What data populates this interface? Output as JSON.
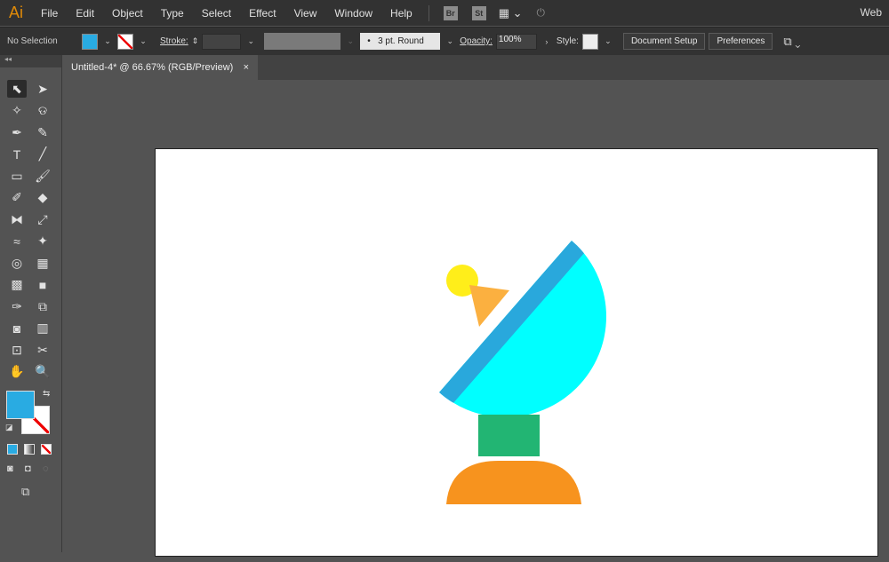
{
  "app": {
    "logo": "Ai",
    "workspace": "Web"
  },
  "menu": [
    "File",
    "Edit",
    "Object",
    "Type",
    "Select",
    "Effect",
    "View",
    "Window",
    "Help"
  ],
  "bridge": "Br",
  "stock": "St",
  "control": {
    "selection": "No Selection",
    "fill_color": "#29abe2",
    "stroke_label": "Stroke:",
    "brush": "3 pt. Round",
    "opacity_label": "Opacity:",
    "opacity": "100%",
    "style_label": "Style:",
    "doc_setup": "Document Setup",
    "preferences": "Preferences"
  },
  "tab": {
    "title": "Untitled-4* @ 66.67% (RGB/Preview)",
    "close": "×"
  },
  "tools": [
    [
      "selection-tool",
      "⬉"
    ],
    [
      "direct-selection-tool",
      "➤"
    ],
    [
      "magic-wand-tool",
      "✧"
    ],
    [
      "lasso-tool",
      "ଡ"
    ],
    [
      "pen-tool",
      "✒"
    ],
    [
      "curvature-tool",
      "✎"
    ],
    [
      "type-tool",
      "T"
    ],
    [
      "line-tool",
      "╱"
    ],
    [
      "rectangle-tool",
      "▭"
    ],
    [
      "paintbrush-tool",
      "🖌"
    ],
    [
      "shaper-tool",
      "✐"
    ],
    [
      "eraser-tool",
      "◆"
    ],
    [
      "reflect-tool",
      "⧓"
    ],
    [
      "scale-tool",
      "⤢"
    ],
    [
      "warp-tool",
      "≈"
    ],
    [
      "puppet-warp-tool",
      "✦"
    ],
    [
      "shape-builder-tool",
      "◎"
    ],
    [
      "perspective-grid-tool",
      "▦"
    ],
    [
      "mesh-tool",
      "▩"
    ],
    [
      "gradient-tool",
      "■"
    ],
    [
      "eyedropper-tool",
      "✑"
    ],
    [
      "blend-tool",
      "⧉"
    ],
    [
      "symbol-sprayer-tool",
      "◙"
    ],
    [
      "column-graph-tool",
      "▥"
    ],
    [
      "artboard-tool",
      "⊡"
    ],
    [
      "slice-tool",
      "✂"
    ],
    [
      "hand-tool",
      "✋"
    ],
    [
      "zoom-tool",
      "🔍"
    ]
  ],
  "colors": {
    "fill": "#29abe2",
    "dish": "#00ffff",
    "dish_rim": "#29a8dc",
    "sun": "#ffee1a",
    "cone": "#fbb040",
    "neck": "#22b573",
    "base": "#f7931e"
  }
}
